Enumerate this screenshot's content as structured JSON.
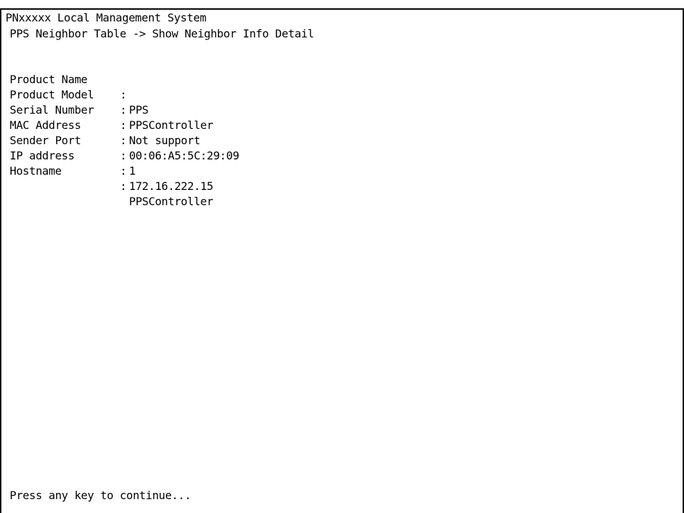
{
  "window": {
    "title": "PNxxxxx Local Management System",
    "breadcrumb": "PPS Neighbor Table -> Show Neighbor Info Detail"
  },
  "details": [
    {
      "label": "Product Name",
      "value": "PPS"
    },
    {
      "label": "Product Model",
      "value": "PPSController"
    },
    {
      "label": "Serial Number",
      "value": "Not support"
    },
    {
      "label": "MAC Address",
      "value": "00:06:A5:5C:29:09"
    },
    {
      "label": "Sender Port",
      "value": "1"
    },
    {
      "label": "IP address",
      "value": "172.16.222.15"
    },
    {
      "label": "Hostname",
      "value": "PPSController"
    }
  ],
  "separator": ":",
  "prompt": "Press any key to continue..."
}
